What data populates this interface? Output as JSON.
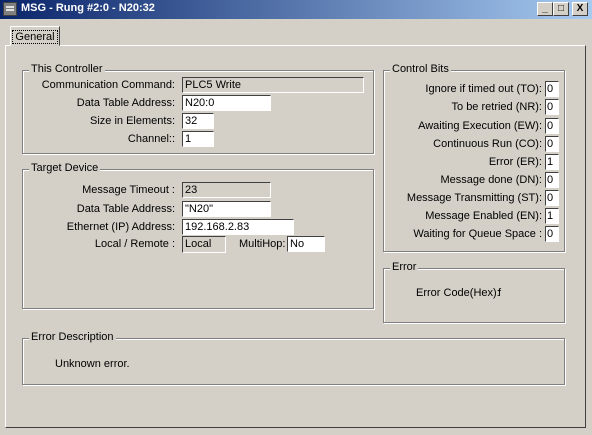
{
  "window": {
    "title": "MSG - Rung #2:0 - N20:32",
    "minimize_label": "_",
    "maximize_label": "□",
    "close_label": "X"
  },
  "tabs": [
    {
      "label": "General"
    }
  ],
  "this_controller": {
    "title": "This Controller",
    "communication_command": {
      "label": "Communication Command:",
      "value": "PLC5 Write"
    },
    "data_table_address": {
      "label": "Data Table Address:",
      "value": "N20:0"
    },
    "size_in_elements": {
      "label": "Size in Elements:",
      "value": "32"
    },
    "channel": {
      "label": "Channel::",
      "value": "1"
    }
  },
  "target_device": {
    "title": "Target Device",
    "message_timeout": {
      "label": "Message Timeout :",
      "value": "23"
    },
    "data_table_address": {
      "label": "Data Table Address:",
      "value": "\"N20\""
    },
    "ethernet_address": {
      "label": "Ethernet (IP) Address:",
      "value": "192.168.2.83"
    },
    "local_remote": {
      "label": "Local / Remote :",
      "value": "Local"
    },
    "multihop": {
      "label": "MultiHop:",
      "value": "No"
    }
  },
  "control_bits": {
    "title": "Control Bits",
    "items": [
      {
        "label": "Ignore if timed out (TO):",
        "value": "0"
      },
      {
        "label": "To be retried (NR):",
        "value": "0"
      },
      {
        "label": "Awaiting Execution (EW):",
        "value": "0"
      },
      {
        "label": "Continuous Run (CO):",
        "value": "0"
      },
      {
        "label": "Error (ER):",
        "value": "1"
      },
      {
        "label": "Message done (DN):",
        "value": "0"
      },
      {
        "label": "Message Transmitting (ST):",
        "value": "0"
      },
      {
        "label": "Message Enabled (EN):",
        "value": "1"
      },
      {
        "label": "Waiting for Queue Space :",
        "value": "0"
      }
    ]
  },
  "error": {
    "title": "Error",
    "code_label": "Error Code(Hex):",
    "code_value": "f"
  },
  "error_description": {
    "title": "Error Description",
    "text": "Unknown error."
  }
}
